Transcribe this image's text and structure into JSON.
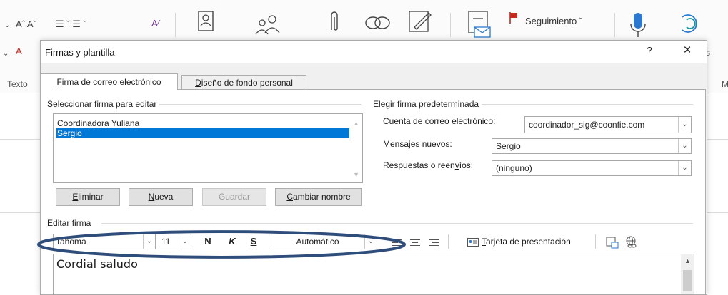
{
  "ribbon": {
    "font_size_glyphs": "Aˆ Aˇ",
    "list_glyphs": "☰ ˇ ☰ ˇ",
    "followup_label": "Seguimiento ˇ",
    "group_text_label": "Texto",
    "right_letter": "M",
    "right_s": "s",
    "accent_flag_color": "#c42b1c",
    "accent_blue": "#2b79d0"
  },
  "dialog": {
    "title": "Firmas y plantilla",
    "help_label": "?",
    "close_label": "×"
  },
  "tabs": [
    {
      "label_pre": "",
      "label_underline": "F",
      "label_post": "irma de correo electrónico",
      "active": true
    },
    {
      "label_pre": "",
      "label_underline": "D",
      "label_post": "iseño de fondo personal",
      "active": false
    }
  ],
  "select_group": {
    "label_underline": "S",
    "label_post": "eleccionar firma para editar",
    "items": [
      {
        "name": "Coordinadora Yuliana",
        "selected": false
      },
      {
        "name": "Sergio",
        "selected": true
      }
    ]
  },
  "buttons": {
    "delete_u": "E",
    "delete_rest": "liminar",
    "new_u": "N",
    "new_rest": "ueva",
    "save_label": "Guardar",
    "rename_u": "C",
    "rename_rest": "ambiar nombre"
  },
  "default_group": {
    "label": "Elegir firma predeterminada",
    "account_label_pre": "Cuen",
    "account_label_u": "t",
    "account_label_post": "a de correo electrónico:",
    "account_value": "coordinador_sig@coonfie.com",
    "new_msgs_label_u": "M",
    "new_msgs_label_post": "ensajes nuevos:",
    "new_msgs_value": "Sergio",
    "replies_label_pre": "Respuestas o reen",
    "replies_label_u": "v",
    "replies_label_post": "íos:",
    "replies_value": "(ninguno)"
  },
  "edit_group": {
    "label_pre": "Edita",
    "label_u": "r",
    "label_post": " firma",
    "font_value": "Tahoma",
    "size_value": "11",
    "bold_label": "N",
    "italic_label": "K",
    "underline_label": "S",
    "color_value": "Automático",
    "business_card_u": "T",
    "business_card_rest": "arjeta de presentación",
    "signature_text": "Cordial saludo"
  }
}
